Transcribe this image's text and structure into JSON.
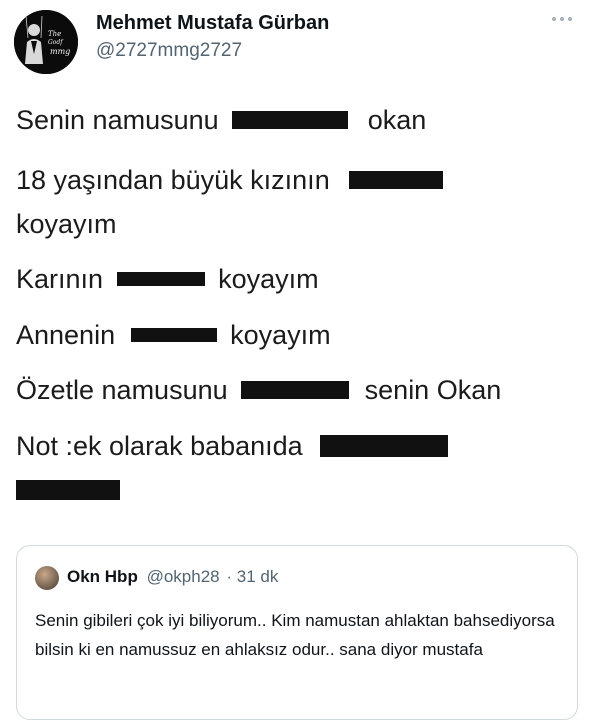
{
  "author": {
    "name": "Mehmet Mustafa Gürban",
    "handle": "@2727mmg2727",
    "avatar_text": "The Godfather mmg"
  },
  "more_icon": "more-dots-icon",
  "tweet_lines": [
    [
      "Senin namusunu",
      "",
      "okan"
    ],
    [
      "18 yaşından büyük kızının",
      ""
    ],
    [
      "koyayım"
    ],
    [
      "Karının",
      "",
      "koyayım"
    ],
    [
      "Annenin",
      "",
      "koyayım"
    ],
    [
      "Özetle namusunu",
      "",
      "senin Okan"
    ],
    [
      "Not :ek olarak babanıda",
      ""
    ],
    [
      ""
    ]
  ],
  "quoted": {
    "name": "Okn Hbp",
    "handle": "@okph28",
    "separator": "·",
    "time": "31 dk",
    "text": "Senin gibileri çok iyi biliyorum.. Kim namustan ahlaktan bahsediyorsa bilsin ki en namussuz en ahlaksız odur.. sana diyor mustafa"
  },
  "colors": {
    "text": "#0f1419",
    "secondary": "#536471",
    "censor_bar": "#111111",
    "border": "#cfd9de"
  }
}
